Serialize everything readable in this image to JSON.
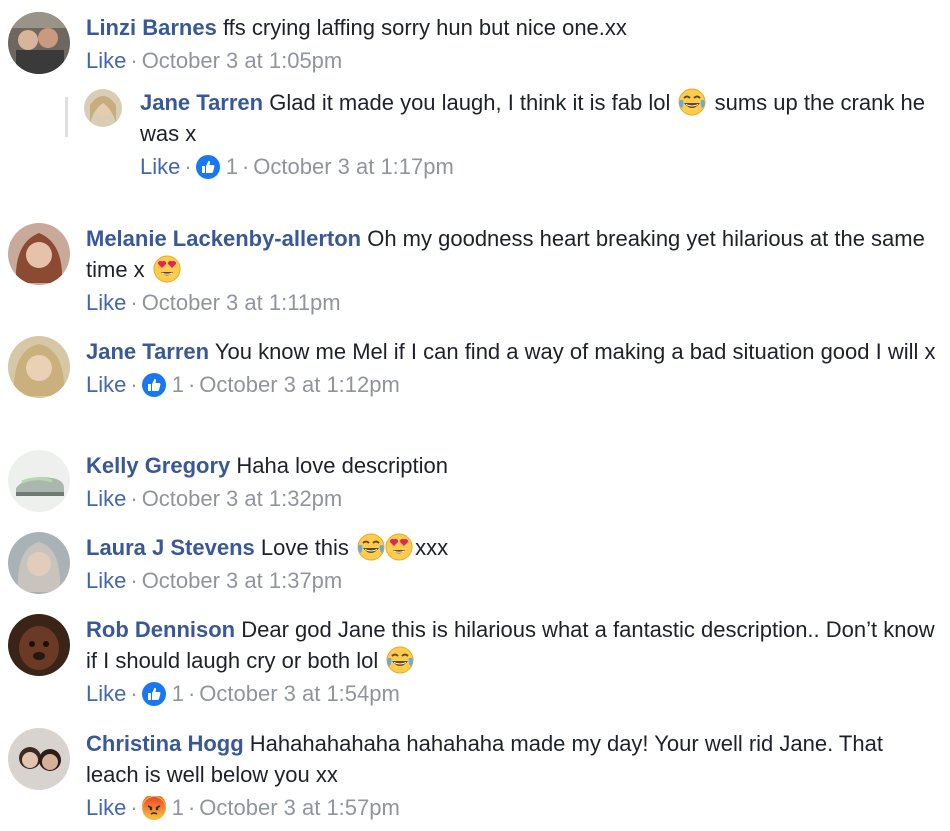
{
  "comments": [
    {
      "author": "Linzi Barnes",
      "text": "ffs crying laffing sorry hun but nice one.xx",
      "like": "Like",
      "time": "October 3 at 1:05pm"
    },
    {
      "author": "Jane Tarren",
      "text1": "Glad it made you laugh, I think it is fab lol",
      "text2": "sums up the crank he was x",
      "like": "Like",
      "count": "1",
      "time": "October 3 at 1:17pm",
      "reaction": "like"
    },
    {
      "author": "Melanie Lackenby-allerton",
      "text": "Oh my goodness heart breaking yet hilarious at the same time x",
      "like": "Like",
      "time": "October 3 at 1:11pm"
    },
    {
      "author": "Jane Tarren",
      "text": "You know me Mel if I can find a way of making a bad situation good I will x",
      "like": "Like",
      "count": "1",
      "time": "October 3 at 1:12pm",
      "reaction": "like"
    },
    {
      "author": "Kelly Gregory",
      "text": "Haha love description",
      "like": "Like",
      "time": "October 3 at 1:32pm"
    },
    {
      "author": "Laura J Stevens",
      "text1": "Love this",
      "text2": "xxx",
      "like": "Like",
      "time": "October 3 at 1:37pm"
    },
    {
      "author": "Rob Dennison",
      "text": "Dear god Jane this is hilarious what a fantastic description.. Don’t know if I should laugh cry or both lol",
      "like": "Like",
      "count": "1",
      "time": "October 3 at 1:54pm",
      "reaction": "like"
    },
    {
      "author": "Christina Hogg",
      "text": "Hahahahahaha hahahaha made my day! Your well rid Jane. That leach is well below you xx",
      "like": "Like",
      "count": "1",
      "time": "October 3 at 1:57pm",
      "reaction": "angry"
    }
  ],
  "colors": {
    "name": "#385898",
    "link": "#4267b2",
    "meta": "#90949c",
    "text": "#1d2129",
    "like_reaction": "#1877f2",
    "angry_reaction": "#e9710f"
  }
}
